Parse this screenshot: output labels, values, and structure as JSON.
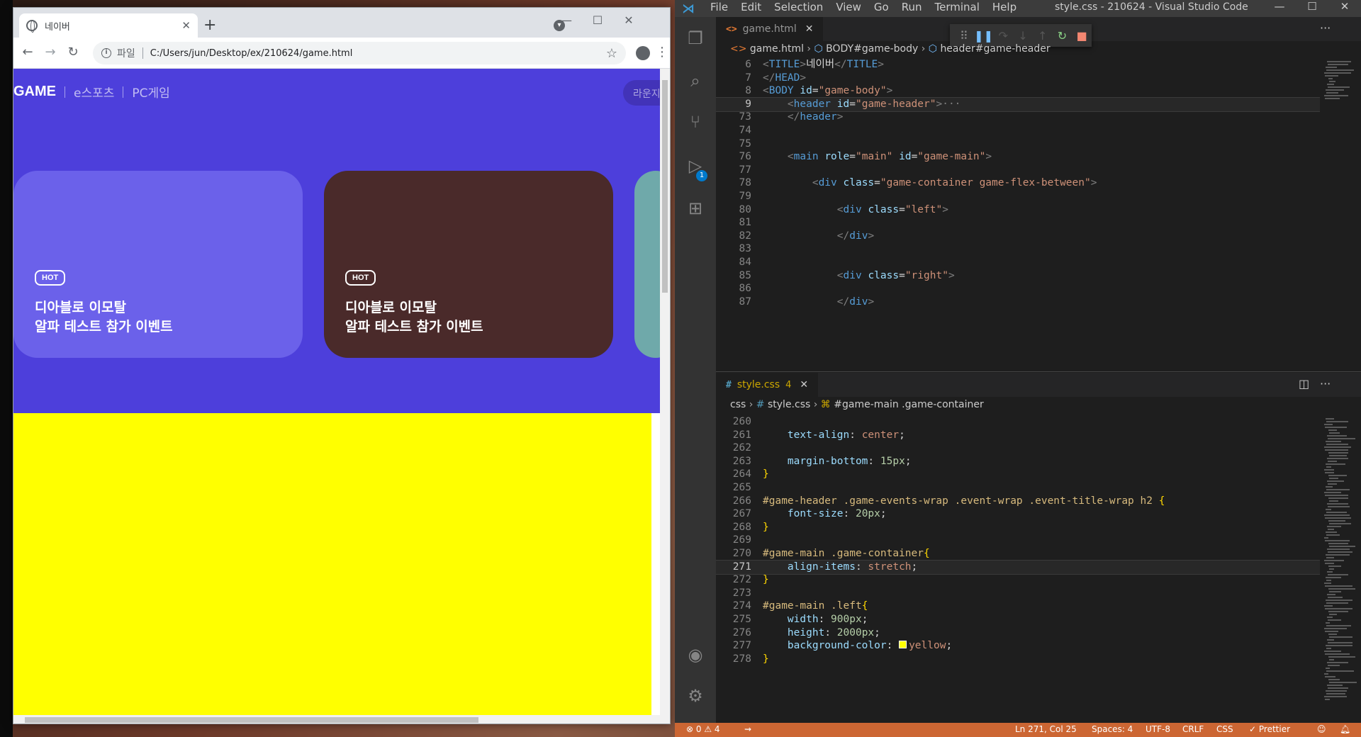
{
  "chrome": {
    "tab_title": "네이버",
    "scheme_label": "파일",
    "url": "C:/Users/jun/Desktop/ex/210624/game.html"
  },
  "page": {
    "brand": "GAME",
    "nav_esports": "e스포츠",
    "nav_pc": "PC게임",
    "lounge": "라운지",
    "cards": [
      {
        "badge": "HOT",
        "line1": "디아블로 이모탈",
        "line2": "알파 테스트 참가 이벤트"
      },
      {
        "badge": "HOT",
        "line1": "디아블로 이모탈",
        "line2": "알파 테스트 참가 이벤트"
      }
    ],
    "colors": {
      "header": "#4d3fdb",
      "main": "#ffff00",
      "card1": "#6b61ea",
      "card2": "#4a2a2a",
      "card3": "#6fa9aa"
    }
  },
  "vscode": {
    "menu": [
      "File",
      "Edit",
      "Selection",
      "View",
      "Go",
      "Run",
      "Terminal",
      "Help"
    ],
    "window_title": "style.css - 210624 - Visual Studio Code",
    "debug_badge": "1",
    "top_tab": "game.html",
    "top_breadcrumb": [
      "game.html",
      "BODY#game-body",
      "header#game-header"
    ],
    "top_lines": [
      {
        "n": "6",
        "html": "<span class='punc'>&lt;</span><span class='tag'>TITLE</span><span class='punc'>&gt;</span>네이버<span class='punc'>&lt;/</span><span class='tag'>TITLE</span><span class='punc'>&gt;</span>"
      },
      {
        "n": "7",
        "html": "<span class='punc'>&lt;/</span><span class='tag'>HEAD</span><span class='punc'>&gt;</span>"
      },
      {
        "n": "8",
        "html": "<span class='punc'>&lt;</span><span class='tag'>BODY</span> <span class='attr'>id</span>=<span class='str'>\"game-body\"</span><span class='punc'>&gt;</span>"
      },
      {
        "n": "9",
        "html": "    <span class='punc'>&lt;</span><span class='tag'>header</span> <span class='attr'>id</span>=<span class='str'>\"game-header\"</span><span class='punc'>&gt;</span><span class='punc'>···</span>",
        "active": true
      },
      {
        "n": "73",
        "html": "    <span class='punc'>&lt;/</span><span class='tag'>header</span><span class='punc'>&gt;</span>"
      },
      {
        "n": "74",
        "html": ""
      },
      {
        "n": "75",
        "html": ""
      },
      {
        "n": "76",
        "html": "    <span class='punc'>&lt;</span><span class='tag'>main</span> <span class='attr'>role</span>=<span class='str'>\"main\"</span> <span class='attr'>id</span>=<span class='str'>\"game-main\"</span><span class='punc'>&gt;</span>"
      },
      {
        "n": "77",
        "html": ""
      },
      {
        "n": "78",
        "html": "        <span class='punc'>&lt;</span><span class='tag'>div</span> <span class='attr'>class</span>=<span class='str'>\"game-container game-flex-between\"</span><span class='punc'>&gt;</span>"
      },
      {
        "n": "79",
        "html": ""
      },
      {
        "n": "80",
        "html": "            <span class='punc'>&lt;</span><span class='tag'>div</span> <span class='attr'>class</span>=<span class='str'>\"left\"</span><span class='punc'>&gt;</span>"
      },
      {
        "n": "81",
        "html": ""
      },
      {
        "n": "82",
        "html": "            <span class='punc'>&lt;/</span><span class='tag'>div</span><span class='punc'>&gt;</span>"
      },
      {
        "n": "83",
        "html": ""
      },
      {
        "n": "84",
        "html": ""
      },
      {
        "n": "85",
        "html": "            <span class='punc'>&lt;</span><span class='tag'>div</span> <span class='attr'>class</span>=<span class='str'>\"right\"</span><span class='punc'>&gt;</span>"
      },
      {
        "n": "86",
        "html": ""
      },
      {
        "n": "87",
        "html": "            <span class='punc'>&lt;/</span><span class='tag'>div</span><span class='punc'>&gt;</span>"
      }
    ],
    "bottom_tab": "style.css",
    "bottom_tab_problems": "4",
    "bottom_breadcrumb": [
      "css",
      "style.css",
      "#game-main .game-container"
    ],
    "bottom_lines": [
      {
        "n": "260",
        "html": ""
      },
      {
        "n": "261",
        "html": "    <span class='prop'>text-align</span>: <span class='val'>center</span>;"
      },
      {
        "n": "262",
        "html": ""
      },
      {
        "n": "263",
        "html": "    <span class='prop'>margin-bottom</span>: <span class='num'>15px</span>;"
      },
      {
        "n": "264",
        "html": "<span class='brace'>}</span>"
      },
      {
        "n": "265",
        "html": ""
      },
      {
        "n": "266",
        "html": "<span class='sel'>#game-header .game-events-wrap .event-wrap .event-title-wrap h2</span> <span class='brace'>{</span>"
      },
      {
        "n": "267",
        "html": "    <span class='prop'>font-size</span>: <span class='num'>20px</span>;"
      },
      {
        "n": "268",
        "html": "<span class='brace'>}</span>"
      },
      {
        "n": "269",
        "html": ""
      },
      {
        "n": "270",
        "html": "<span class='sel'>#game-main .game-container</span><span class='brace'>{</span>"
      },
      {
        "n": "271",
        "html": "    <span class='prop'>align-items</span>: <span class='val'>stretch</span>;",
        "active": true
      },
      {
        "n": "272",
        "html": "<span class='brace'>}</span>"
      },
      {
        "n": "273",
        "html": ""
      },
      {
        "n": "274",
        "html": "<span class='sel'>#game-main .left</span><span class='brace'>{</span>"
      },
      {
        "n": "275",
        "html": "    <span class='prop'>width</span>: <span class='num'>900px</span>;"
      },
      {
        "n": "276",
        "html": "    <span class='prop'>height</span>: <span class='num'>2000px</span>;"
      },
      {
        "n": "277",
        "html": "    <span class='prop'>background-color</span>: <span style='display:inline-block;width:11px;height:11px;background:#ffff00;border:1px solid #fff;margin-right:3px'></span><span class='val'>yellow</span>;"
      },
      {
        "n": "278",
        "html": "<span class='brace'>}</span>"
      }
    ],
    "status": {
      "problems": "⊗ 0 ⚠ 4",
      "position": "Ln 271, Col 25",
      "spaces": "Spaces: 4",
      "encoding": "UTF-8",
      "eol": "CRLF",
      "language": "CSS",
      "prettier": "✓ Prettier"
    }
  }
}
